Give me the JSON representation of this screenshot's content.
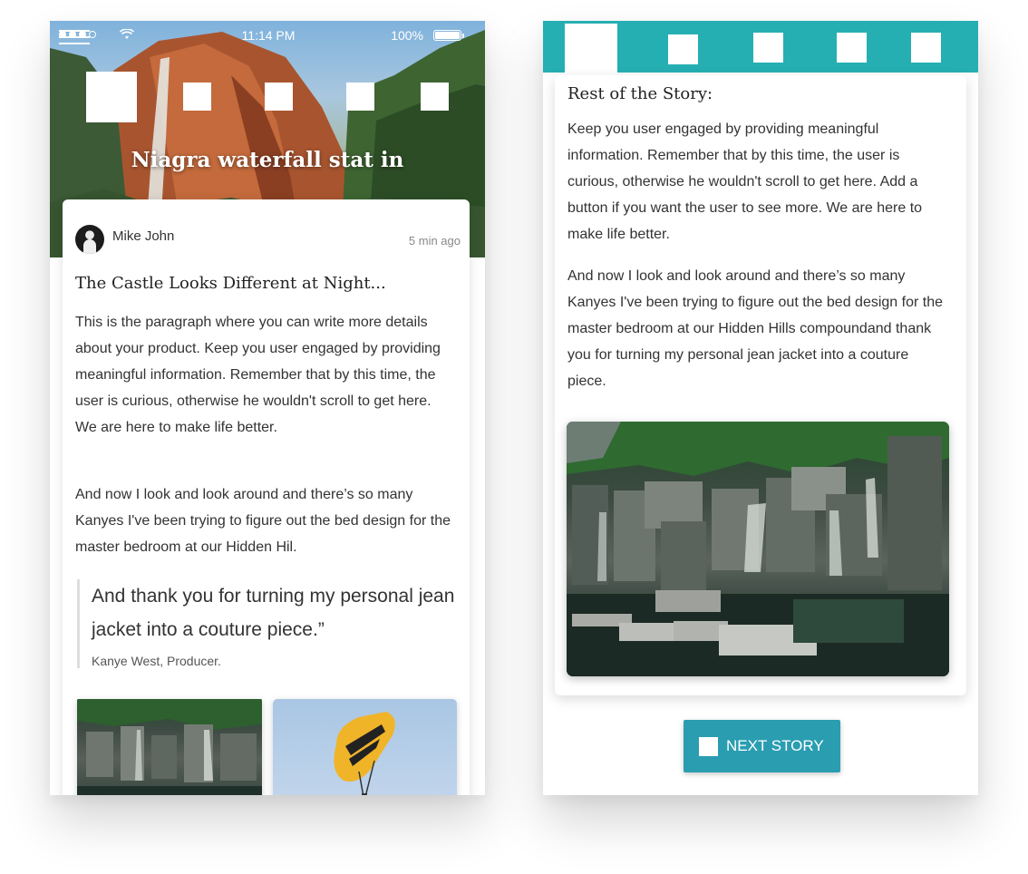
{
  "left_phone": {
    "status_bar": {
      "time": "11:14 PM",
      "battery": "100%",
      "icons": [
        "signal-icon",
        "wifi-icon",
        "battery-icon"
      ]
    },
    "hero": {
      "title": "Niagra waterfall stat in"
    },
    "article": {
      "author": "Mike John",
      "time_ago": "5 min ago",
      "title": "The Castle Looks Different at Night...",
      "paragraph_1": "This is the paragraph where you can write more details about your product. Keep you user engaged by providing meaningful information. Remember that by this time, the user is curious, otherwise he wouldn't scroll to get here. We are here to make life better.",
      "paragraph_2": "And now I look and look around and there’s so many Kanyes I've been trying to figure out the bed design for the master bedroom at our Hidden Hil.",
      "quote": "And thank you for turning my personal jean jacket into a couture piece.”",
      "quote_author": "Kanye West, Producer."
    }
  },
  "right_phone": {
    "heading": "Rest of the Story:",
    "paragraph_1": "Keep you user engaged by providing meaningful information. Remember that by this time, the user is curious, otherwise he wouldn't scroll to get here. Add a button if you want the user to see more. We are here to make life better.",
    "paragraph_2": "And now I look and look around and there’s so many Kanyes I've been trying to figure out the bed design for the master bedroom at our Hidden Hills compoundand thank you for turning my personal jean jacket into a couture piece.",
    "next_button": "NEXT STORY"
  },
  "colors": {
    "tab_bar": "#26afb3",
    "button": "#2a9db1",
    "text": "#333333",
    "card_background": "#ffffff"
  }
}
